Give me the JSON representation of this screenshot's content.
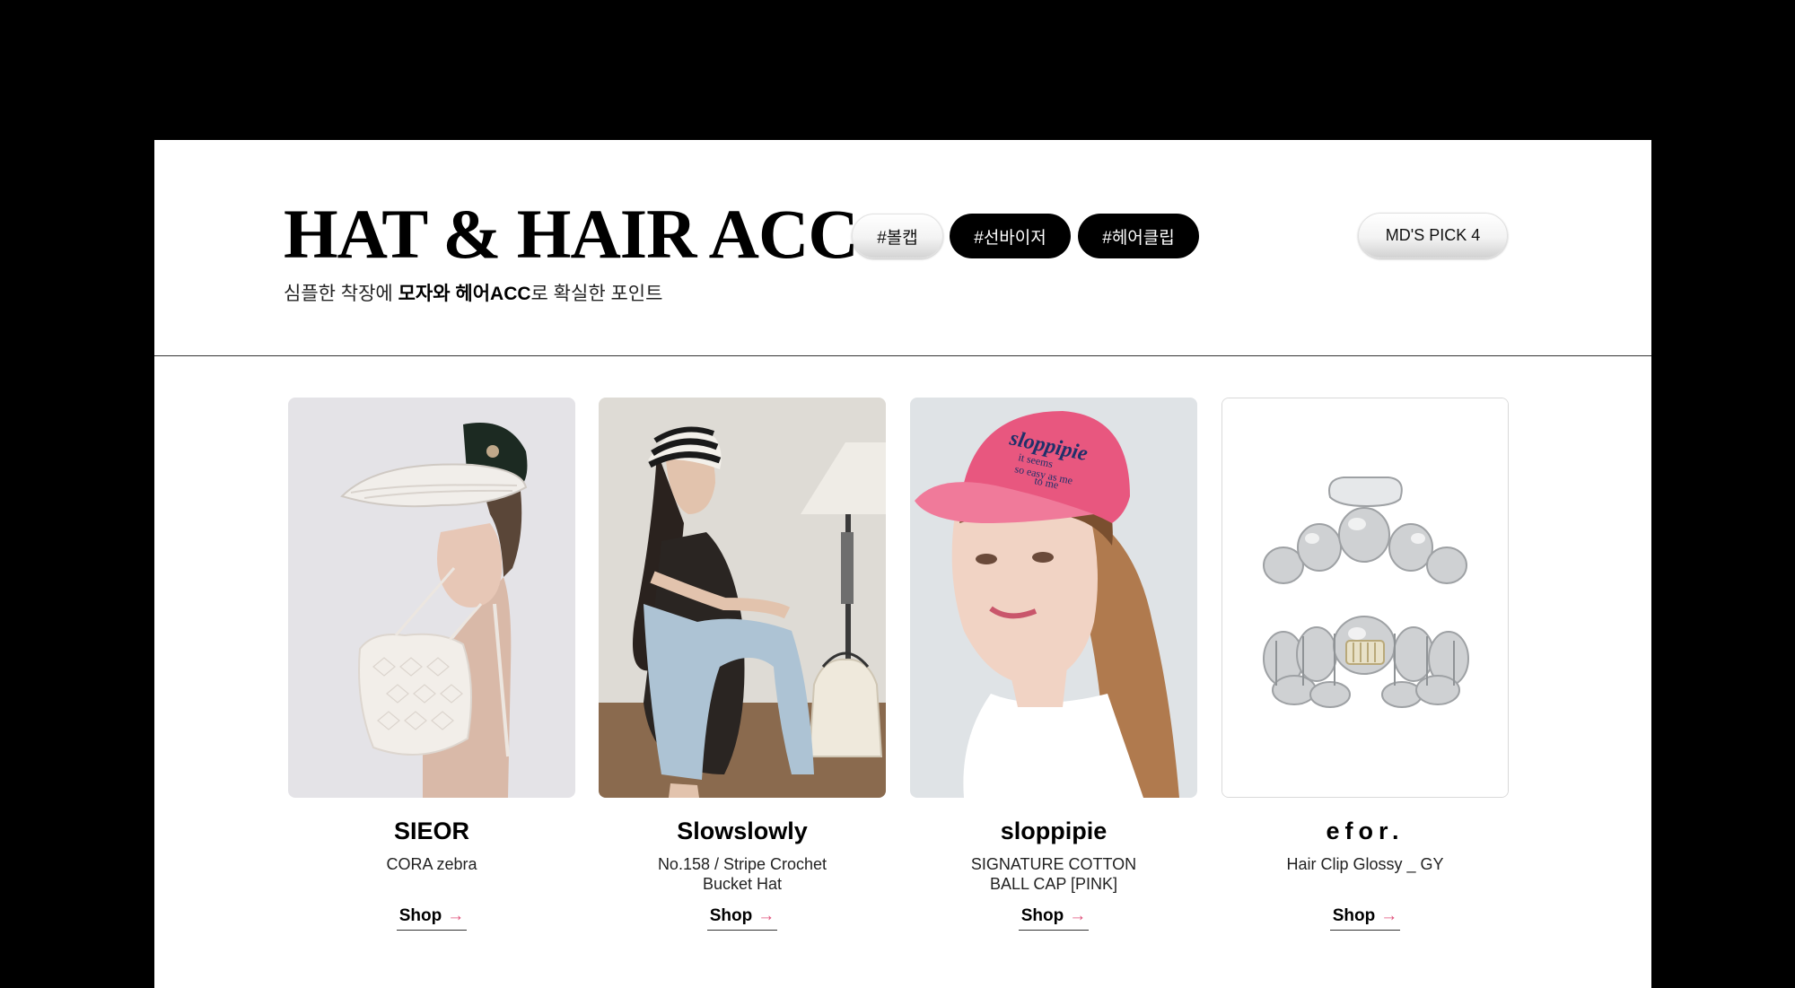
{
  "header": {
    "title": "HAT & HAIR ACC",
    "subtitle_pre": "심플한 착장에 ",
    "subtitle_bold": "모자와 헤어ACC",
    "subtitle_post": "로 확실한 포인트"
  },
  "tags": [
    {
      "label": "#볼캡",
      "style": "light"
    },
    {
      "label": "#선바이저",
      "style": "dark"
    },
    {
      "label": "#헤어클립",
      "style": "dark"
    }
  ],
  "md_pick": {
    "label": "MD'S PICK 4"
  },
  "products": [
    {
      "brand": "SIEOR",
      "name": "CORA zebra",
      "shop_label": "Shop",
      "arrow": "→"
    },
    {
      "brand": "Slowslowly",
      "name": "No.158 / Stripe Crochet\nBucket Hat",
      "shop_label": "Shop",
      "arrow": "→"
    },
    {
      "brand": "sloppipie",
      "name": "SIGNATURE COTTON\nBALL CAP [PINK]",
      "shop_label": "Shop",
      "arrow": "→"
    },
    {
      "brand": "efor.",
      "name": "Hair Clip Glossy _ GY",
      "shop_label": "Shop",
      "arrow": "→"
    }
  ],
  "cap_print": {
    "logo": "sloppipie",
    "line1": "it seems",
    "line2": "so easy as me",
    "line3": "to me"
  },
  "colors": {
    "background": "#000000",
    "panel": "#ffffff",
    "tag_dark": "#000000",
    "arrow": "#e0507a",
    "cap_pink": "#e8577f"
  }
}
